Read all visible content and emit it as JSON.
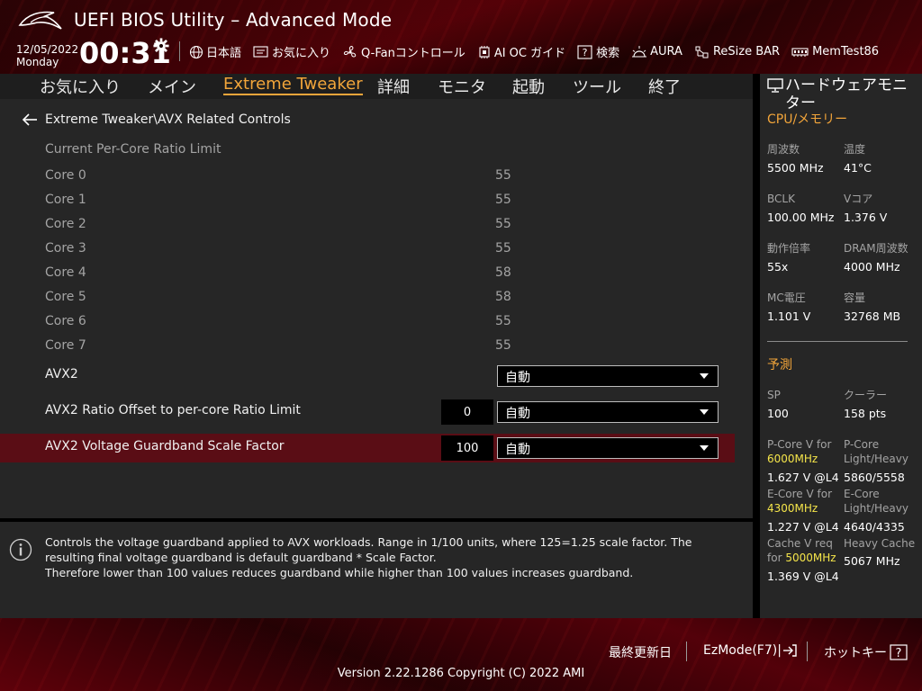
{
  "header": {
    "title": "UEFI BIOS Utility – Advanced Mode",
    "date": "12/05/2022",
    "day": "Monday",
    "time": "00:31",
    "toolbar": [
      {
        "name": "language",
        "label": "日本語",
        "icon": "globe-icon"
      },
      {
        "name": "favorites",
        "label": "お気に入り",
        "icon": "favorites-icon"
      },
      {
        "name": "qfan",
        "label": "Q-Fanコントロール",
        "icon": "fan-icon"
      },
      {
        "name": "ai-oc",
        "label": "AI OC ガイド",
        "icon": "ai-oc-icon"
      },
      {
        "name": "search",
        "label": "検索",
        "icon": "help-search-icon"
      },
      {
        "name": "aura",
        "label": "AURA",
        "icon": "aura-icon"
      },
      {
        "name": "resize-bar",
        "label": "ReSize BAR",
        "icon": "resize-bar-icon"
      },
      {
        "name": "memtest",
        "label": "MemTest86",
        "icon": "memtest-icon"
      }
    ]
  },
  "nav": {
    "tabs": [
      {
        "label": "お気に入り",
        "active": false
      },
      {
        "label": "メイン",
        "active": false
      },
      {
        "label": "Extreme Tweaker",
        "active": true
      },
      {
        "label": "詳細",
        "active": false
      },
      {
        "label": "モニタ",
        "active": false
      },
      {
        "label": "起動",
        "active": false
      },
      {
        "label": "ツール",
        "active": false
      },
      {
        "label": "終了",
        "active": false
      }
    ]
  },
  "main": {
    "breadcrumb": "Extreme Tweaker\\AVX Related Controls",
    "section_label": "Current Per-Core Ratio Limit",
    "cores": [
      {
        "label": "Core 0",
        "value": "55"
      },
      {
        "label": "Core 1",
        "value": "55"
      },
      {
        "label": "Core 2",
        "value": "55"
      },
      {
        "label": "Core 3",
        "value": "55"
      },
      {
        "label": "Core 4",
        "value": "58"
      },
      {
        "label": "Core 5",
        "value": "58"
      },
      {
        "label": "Core 6",
        "value": "55"
      },
      {
        "label": "Core 7",
        "value": "55"
      }
    ],
    "avx2": {
      "label": "AVX2",
      "selected": "自動"
    },
    "avx2_offset": {
      "label": "AVX2 Ratio Offset to per-core Ratio Limit",
      "value": "0",
      "selected": "自動"
    },
    "avx2_guardband": {
      "label": "AVX2 Voltage Guardband Scale Factor",
      "value": "100",
      "selected": "自動"
    }
  },
  "help": {
    "line1": "Controls the voltage guardband applied to AVX workloads. Range in 1/100 units, where 125=1.25 scale factor. The resulting final voltage guardband is default guardband * Scale Factor.",
    "line2": "Therefore lower than 100 values reduces guardband while higher than 100 values increases guardband."
  },
  "monitor": {
    "title": "ハードウェアモニター",
    "cpu_section": "CPU/メモリー",
    "freq_label": "周波数",
    "freq_value": "5500 MHz",
    "temp_label": "温度",
    "temp_value": "41°C",
    "bclk_label": "BCLK",
    "bclk_value": "100.00 MHz",
    "vcore_label": "Vコア",
    "vcore_value": "1.376 V",
    "ratio_label": "動作倍率",
    "ratio_value": "55x",
    "dram_label": "DRAM周波数",
    "dram_value": "4000 MHz",
    "mc_label": "MC電圧",
    "mc_value": "1.101 V",
    "cap_label": "容量",
    "cap_value": "32768 MB",
    "predict_section": "予測",
    "sp_label": "SP",
    "sp_value": "100",
    "cooler_label": "クーラー",
    "cooler_value": "158 pts",
    "pcore_v_label": "P-Core V for",
    "pcore_v_freq": "6000MHz",
    "pcore_v_value": "1.627 V @L4",
    "pcore_lh_label1": "P-Core",
    "pcore_lh_label2": "Light/Heavy",
    "pcore_lh_value": "5860/5558",
    "ecore_v_label": "E-Core V for",
    "ecore_v_freq": "4300MHz",
    "ecore_v_value": "1.227 V @L4",
    "ecore_lh_label1": "E-Core",
    "ecore_lh_label2": "Light/Heavy",
    "ecore_lh_value": "4640/4335",
    "cache_v_label1": "Cache V req",
    "cache_v_label2": "for",
    "cache_v_freq": "5000MHz",
    "cache_v_value": "1.369 V @L4",
    "heavy_cache_label": "Heavy Cache",
    "heavy_cache_value": "5067 MHz"
  },
  "footer": {
    "last_modified": "最終更新日",
    "ezmode": "EzMode(F7)|",
    "hotkeys": "ホットキー",
    "version": "Version 2.22.1286 Copyright (C) 2022 AMI"
  }
}
